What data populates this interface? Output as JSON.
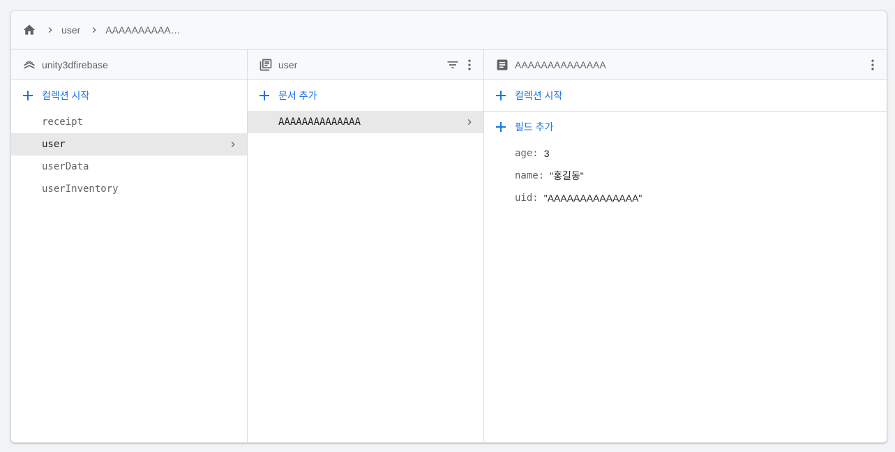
{
  "breadcrumb": {
    "home_icon": "home-icon",
    "items": [
      "user",
      "AAAAAAAAAAA..."
    ]
  },
  "root_panel": {
    "title": "unity3dfirebase",
    "icon": "firestore-icon",
    "add_label": "컬렉션 시작",
    "items": [
      "receipt",
      "user",
      "userData",
      "userInventory"
    ],
    "selected": "user"
  },
  "collection_panel": {
    "title": "user",
    "icon": "collection-icon",
    "add_label": "문서 추가",
    "items": [
      "AAAAAAAAAAAAAA"
    ],
    "selected": "AAAAAAAAAAAAAA"
  },
  "document_panel": {
    "title": "AAAAAAAAAAAAAA",
    "icon": "document-icon",
    "add_collection_label": "컬렉션 시작",
    "add_field_label": "필드 추가",
    "fields": [
      {
        "key": "age:",
        "value": "3"
      },
      {
        "key": "name:",
        "value": "\"홍길동\""
      },
      {
        "key": "uid:",
        "value": "\"AAAAAAAAAAAAAA\""
      }
    ]
  },
  "colors": {
    "accent": "#1a73e8",
    "selected_bg": "#e8e8e8",
    "header_bg": "#f8f9fa",
    "border": "#dadce0"
  }
}
